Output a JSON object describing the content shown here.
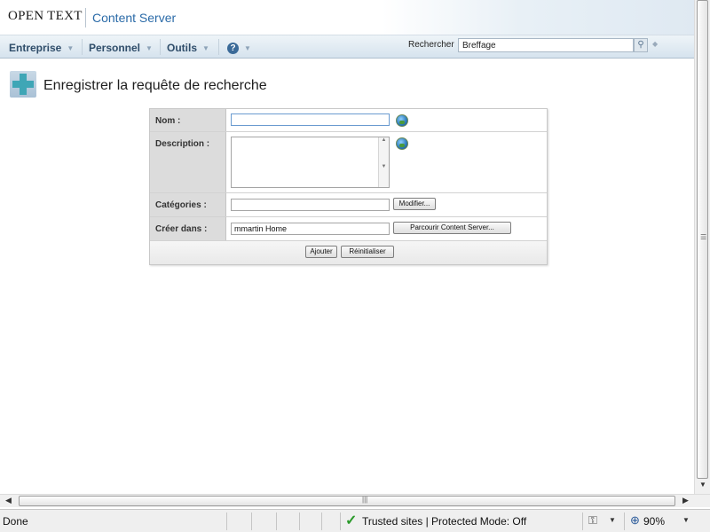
{
  "header": {
    "logo": "OPEN TEXT",
    "product": "Content Server"
  },
  "nav": {
    "menus": [
      "Entreprise",
      "Personnel",
      "Outils"
    ],
    "help_icon": "?",
    "search_label": "Rechercher",
    "search_value": "Breffage"
  },
  "page": {
    "title": "Enregistrer la requête de recherche"
  },
  "form": {
    "name_label": "Nom :",
    "name_value": "",
    "description_label": "Description :",
    "description_value": "",
    "categories_label": "Catégories :",
    "categories_value": "",
    "modify_button": "Modifier...",
    "create_in_label": "Créer dans :",
    "create_in_value": "mmartin Home",
    "browse_button": "Parcourir Content Server...",
    "add_button": "Ajouter",
    "reset_button": "Réinitialiser"
  },
  "statusbar": {
    "status": "Done",
    "zone": "Trusted sites | Protected Mode: Off",
    "zoom": "90%"
  },
  "icons": {
    "add": "plus-icon",
    "globe": "globe-icon",
    "search": "magnifier-icon",
    "trusted": "checkmark-icon",
    "zoom": "zoom-icon"
  },
  "colors": {
    "accent": "#2b6ba8",
    "nav_text": "#2f4d6a",
    "label_bg": "#dcdcdc"
  }
}
